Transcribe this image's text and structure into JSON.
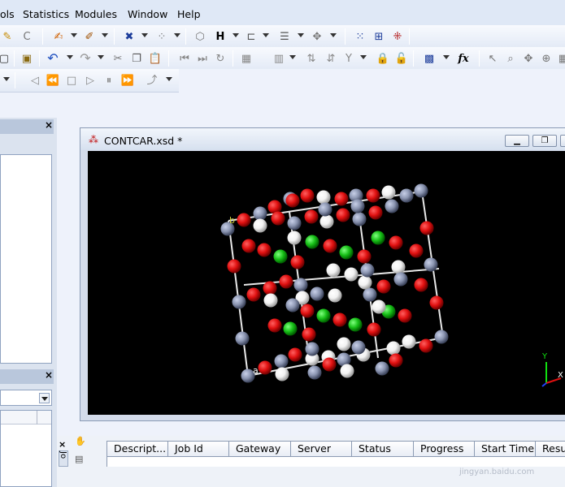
{
  "menu": [
    "ols",
    "Statistics",
    "Modules",
    "Window",
    "Help"
  ],
  "document": {
    "title": "CONTCAR.xsd *",
    "axis_labels": {
      "y": "Y",
      "x": "X"
    },
    "cell_letters": {
      "b": "b",
      "a": "a"
    }
  },
  "left_panel": {
    "job_tab": "Jo"
  },
  "jobs": {
    "columns": [
      "Descript...",
      "Job Id",
      "Gateway",
      "Server",
      "Status",
      "Progress",
      "Start Time",
      "Result"
    ]
  },
  "watermark": "jingyan.baidu.com",
  "colors": {
    "oxygen": "#e01010",
    "metal_gray": "#8a94b0",
    "hydrogen_white": "#f2f2f2",
    "green_atom": "#18c018",
    "viewport_bg": "#000000",
    "menubar_bg": "#dfe8f6"
  },
  "icons": [
    "pencil-icon",
    "bond-icon",
    "undo-icon",
    "redo-icon",
    "cut-icon",
    "copy-icon",
    "paste-icon",
    "zoom-icon",
    "rotate-icon",
    "fx-icon",
    "select-arrow-icon",
    "hand-icon"
  ]
}
